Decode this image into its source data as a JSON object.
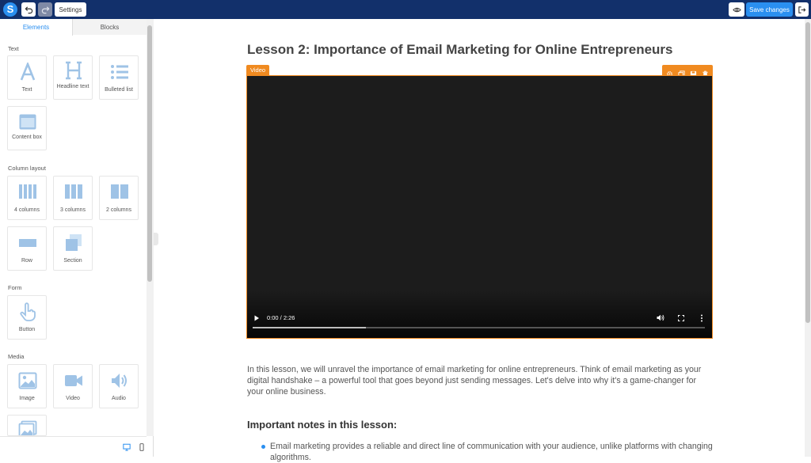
{
  "toolbar": {
    "logo_letter": "S",
    "settings_label": "Settings",
    "save_label": "Save changes"
  },
  "sidebar": {
    "tabs": [
      {
        "label": "Elements"
      },
      {
        "label": "Blocks"
      }
    ],
    "sections": {
      "text": "Text",
      "columns": "Column layout",
      "form": "Form",
      "media": "Media"
    },
    "elements": {
      "text": "Text",
      "headline": "Headline text",
      "bulleted": "Bulleted list",
      "content_box": "Content box",
      "col4": "4 columns",
      "col3": "3 columns",
      "col2": "2 columns",
      "row": "Row",
      "section": "Section",
      "button": "Button",
      "image": "Image",
      "video": "Video",
      "audio": "Audio"
    }
  },
  "canvas": {
    "title": "Lesson 2:  Importance of Email Marketing for Online Entrepreneurs",
    "video": {
      "tag": "Video",
      "time": "0:00 / 2:26",
      "progress": 0.25
    },
    "intro": "In this lesson, we will unravel the importance of email marketing for online entrepreneurs. Think of email marketing as your digital handshake – a powerful tool that goes beyond just sending messages. Let's delve into why it's a game-changer for your online business.",
    "notes_title": "Important notes in this lesson:",
    "bullets": [
      "Email marketing provides a reliable and direct line of communication with your audience, unlike platforms with changing algorithms."
    ]
  },
  "colors": {
    "topbar": "#12306b",
    "accent": "#2a8ff0",
    "selection": "#f08a20",
    "icon": "#9fc3e6"
  }
}
